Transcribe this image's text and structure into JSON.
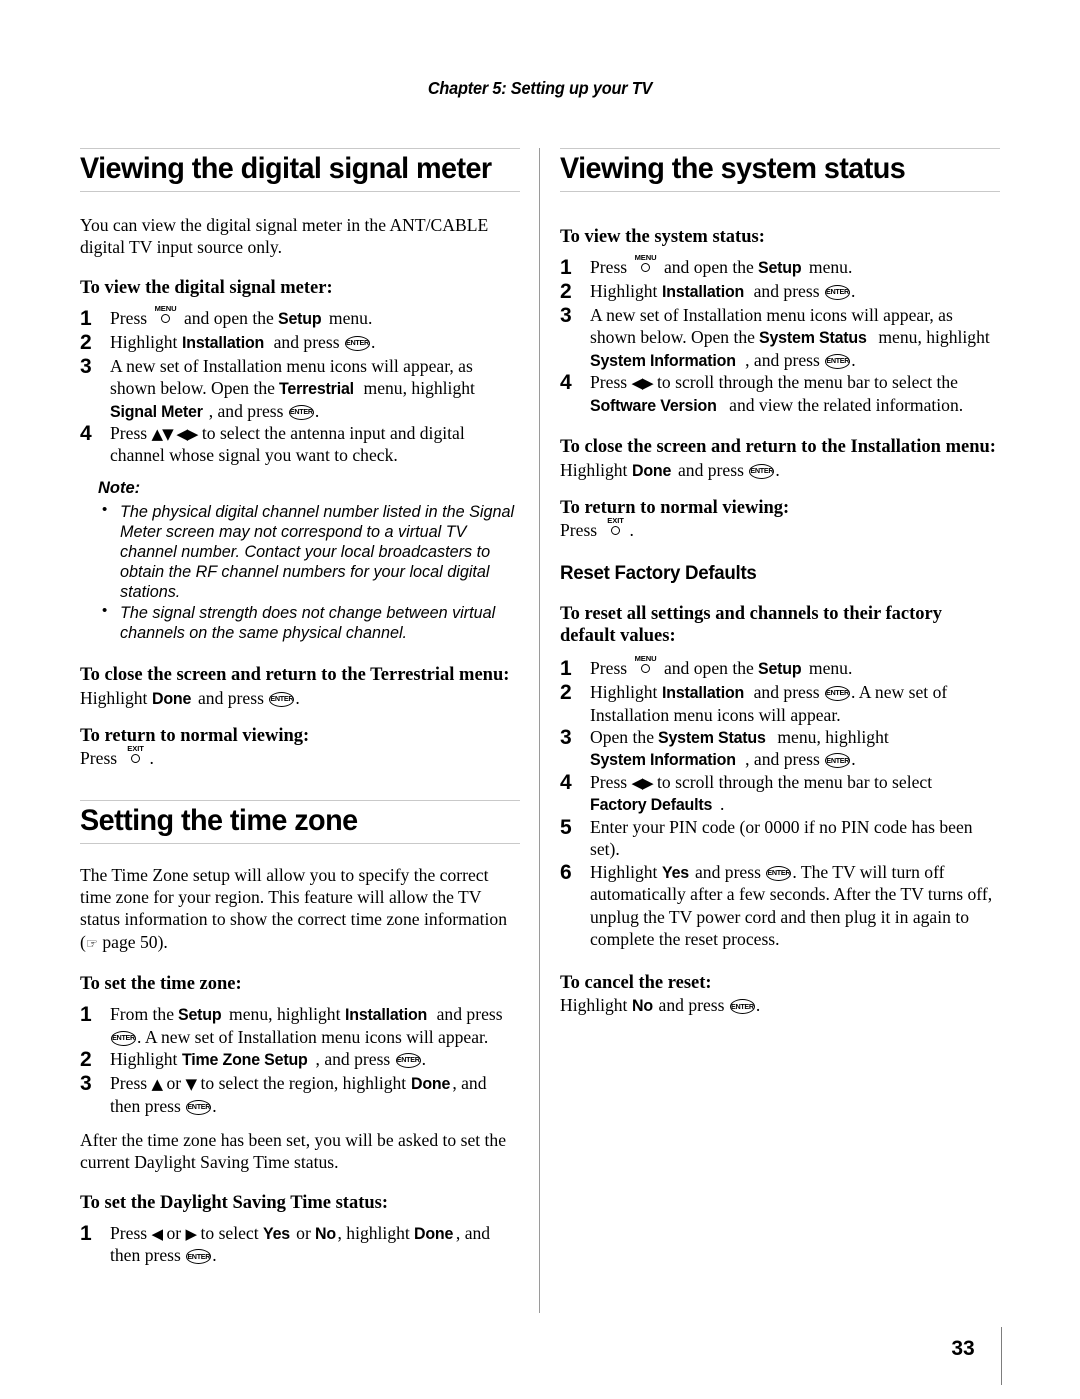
{
  "header": {
    "running_head": "Chapter 5: Setting up your TV"
  },
  "folio": {
    "page_number": "33"
  },
  "icons": {
    "menu_caption": "MENU",
    "exit_caption": "EXIT",
    "enter_caption": "ENTER",
    "up_arrow": "▲",
    "down_arrow": "▼",
    "left_arrow": "◀",
    "right_arrow": "▶",
    "hand_pointer": "☞"
  },
  "left_column": {
    "section1": {
      "title": "Viewing the digital signal meter",
      "intro": "You can view the digital signal meter in the ANT/CABLE digital TV input source only.",
      "proc1_title": "To view the digital signal meter:",
      "proc1_steps": [
        {
          "num": "1",
          "parts": [
            {
              "t": "text",
              "v": "Press "
            },
            {
              "t": "key-menu"
            },
            {
              "t": "text",
              "v": " and open the "
            },
            {
              "t": "bold",
              "v": "Setup"
            },
            {
              "t": "text",
              "v": " menu."
            }
          ]
        },
        {
          "num": "2",
          "parts": [
            {
              "t": "text",
              "v": "Highlight "
            },
            {
              "t": "bold",
              "v": "Installation"
            },
            {
              "t": "text",
              "v": " and press "
            },
            {
              "t": "key-enter"
            },
            {
              "t": "text",
              "v": "."
            }
          ]
        },
        {
          "num": "3",
          "parts": [
            {
              "t": "text",
              "v": "A new set of Installation menu icons will appear, as shown below. Open the "
            },
            {
              "t": "bold",
              "v": "Terrestrial"
            },
            {
              "t": "text",
              "v": " menu, highlight "
            },
            {
              "t": "bold",
              "v": "Signal Meter"
            },
            {
              "t": "text",
              "v": ", and press "
            },
            {
              "t": "key-enter"
            },
            {
              "t": "text",
              "v": "."
            }
          ]
        },
        {
          "num": "4",
          "parts": [
            {
              "t": "text",
              "v": "Press "
            },
            {
              "t": "arrows",
              "v": "▲▼ ◀▶"
            },
            {
              "t": "text",
              "v": " to select the antenna input and digital channel whose signal you want to check."
            }
          ]
        }
      ],
      "note_title": "Note:",
      "note_items": [
        "The physical digital channel number listed in the Signal Meter screen may not correspond to a virtual TV channel number. Contact your local broadcasters to obtain the RF channel numbers for your local digital stations.",
        "The signal strength does not change between virtual channels on the same physical channel."
      ],
      "proc2_title": "To close the screen and return to the Terrestrial menu:",
      "proc2_body": [
        {
          "t": "text",
          "v": "Highlight "
        },
        {
          "t": "bold",
          "v": "Done"
        },
        {
          "t": "text",
          "v": " and press "
        },
        {
          "t": "key-enter"
        },
        {
          "t": "text",
          "v": "."
        }
      ],
      "proc3_title": "To return to normal viewing:",
      "proc3_body": [
        {
          "t": "text",
          "v": "Press "
        },
        {
          "t": "key-exit"
        },
        {
          "t": "text",
          "v": "."
        }
      ]
    },
    "section2": {
      "title": "Setting the time zone",
      "intro_parts": [
        {
          "t": "text",
          "v": "The Time Zone setup will allow you to specify the correct time zone for your region. This feature will allow the TV status information to show the correct time zone information ("
        },
        {
          "t": "hand"
        },
        {
          "t": "text",
          "v": " page 50)."
        }
      ],
      "proc1_title": "To set the time zone:",
      "proc1_steps": [
        {
          "num": "1",
          "parts": [
            {
              "t": "text",
              "v": "From the "
            },
            {
              "t": "bold",
              "v": "Setup"
            },
            {
              "t": "text",
              "v": " menu, highlight "
            },
            {
              "t": "bold",
              "v": "Installation"
            },
            {
              "t": "text",
              "v": " and press "
            },
            {
              "t": "key-enter"
            },
            {
              "t": "text",
              "v": ". A new set of Installation menu icons will appear."
            }
          ]
        },
        {
          "num": "2",
          "parts": [
            {
              "t": "text",
              "v": "Highlight "
            },
            {
              "t": "bold",
              "v": "Time Zone Setup"
            },
            {
              "t": "text",
              "v": ", and press "
            },
            {
              "t": "key-enter"
            },
            {
              "t": "text",
              "v": "."
            }
          ]
        },
        {
          "num": "3",
          "parts": [
            {
              "t": "text",
              "v": "Press "
            },
            {
              "t": "arrows",
              "v": "▲"
            },
            {
              "t": "text",
              "v": " or "
            },
            {
              "t": "arrows",
              "v": "▼"
            },
            {
              "t": "text",
              "v": " to select the region, highlight "
            },
            {
              "t": "bold",
              "v": "Done"
            },
            {
              "t": "text",
              "v": ", and then press "
            },
            {
              "t": "key-enter"
            },
            {
              "t": "text",
              "v": "."
            }
          ]
        }
      ],
      "after_text": "After the time zone has been set, you will be asked to set the current Daylight Saving Time status.",
      "proc2_title": "To set the Daylight Saving Time status:",
      "proc2_steps": [
        {
          "num": "1",
          "parts": [
            {
              "t": "text",
              "v": "Press "
            },
            {
              "t": "arrows",
              "v": "◀"
            },
            {
              "t": "text",
              "v": " or "
            },
            {
              "t": "arrows",
              "v": "▶"
            },
            {
              "t": "text",
              "v": " to select "
            },
            {
              "t": "bold",
              "v": "Yes"
            },
            {
              "t": "text",
              "v": " or "
            },
            {
              "t": "bold",
              "v": "No"
            },
            {
              "t": "text",
              "v": ", highlight "
            },
            {
              "t": "bold",
              "v": "Done"
            },
            {
              "t": "text",
              "v": ", and then press "
            },
            {
              "t": "key-enter"
            },
            {
              "t": "text",
              "v": "."
            }
          ]
        }
      ]
    }
  },
  "right_column": {
    "section1": {
      "title": "Viewing the system status",
      "proc1_title": "To view the system status:",
      "proc1_steps": [
        {
          "num": "1",
          "parts": [
            {
              "t": "text",
              "v": "Press "
            },
            {
              "t": "key-menu"
            },
            {
              "t": "text",
              "v": " and open the "
            },
            {
              "t": "bold",
              "v": "Setup"
            },
            {
              "t": "text",
              "v": " menu."
            }
          ]
        },
        {
          "num": "2",
          "parts": [
            {
              "t": "text",
              "v": "Highlight "
            },
            {
              "t": "bold",
              "v": "Installation"
            },
            {
              "t": "text",
              "v": " and press "
            },
            {
              "t": "key-enter"
            },
            {
              "t": "text",
              "v": "."
            }
          ]
        },
        {
          "num": "3",
          "parts": [
            {
              "t": "text",
              "v": "A new set of Installation menu icons will appear, as shown below. Open the "
            },
            {
              "t": "bold",
              "v": "System Status"
            },
            {
              "t": "text",
              "v": " menu, highlight "
            },
            {
              "t": "bold",
              "v": "System Information"
            },
            {
              "t": "text",
              "v": ", and press "
            },
            {
              "t": "key-enter"
            },
            {
              "t": "text",
              "v": "."
            }
          ]
        },
        {
          "num": "4",
          "parts": [
            {
              "t": "text",
              "v": "Press "
            },
            {
              "t": "arrows",
              "v": "◀▶"
            },
            {
              "t": "text",
              "v": " to scroll through the menu bar to select the "
            },
            {
              "t": "bold",
              "v": "Software Version"
            },
            {
              "t": "text",
              "v": " and view the related information."
            }
          ]
        }
      ],
      "proc2_title": "To close the screen and return to the Installation menu:",
      "proc2_body": [
        {
          "t": "text",
          "v": "Highlight "
        },
        {
          "t": "bold",
          "v": "Done"
        },
        {
          "t": "text",
          "v": " and press "
        },
        {
          "t": "key-enter"
        },
        {
          "t": "text",
          "v": "."
        }
      ],
      "proc3_title": "To return to normal viewing:",
      "proc3_body": [
        {
          "t": "text",
          "v": "Press "
        },
        {
          "t": "key-exit"
        },
        {
          "t": "text",
          "v": "."
        }
      ]
    },
    "section2": {
      "title": "Reset Factory Defaults",
      "proc1_title": "To reset all settings and channels to their factory default values:",
      "proc1_steps": [
        {
          "num": "1",
          "parts": [
            {
              "t": "text",
              "v": "Press "
            },
            {
              "t": "key-menu"
            },
            {
              "t": "text",
              "v": " and open the "
            },
            {
              "t": "bold",
              "v": "Setup"
            },
            {
              "t": "text",
              "v": " menu."
            }
          ]
        },
        {
          "num": "2",
          "parts": [
            {
              "t": "text",
              "v": "Highlight "
            },
            {
              "t": "bold",
              "v": "Installation"
            },
            {
              "t": "text",
              "v": " and press "
            },
            {
              "t": "key-enter"
            },
            {
              "t": "text",
              "v": ". A new set of Installation menu icons will appear."
            }
          ]
        },
        {
          "num": "3",
          "parts": [
            {
              "t": "text",
              "v": "Open the "
            },
            {
              "t": "bold",
              "v": "System Status"
            },
            {
              "t": "text",
              "v": " menu, highlight "
            },
            {
              "t": "bold",
              "v": "System Information"
            },
            {
              "t": "text",
              "v": ", and press "
            },
            {
              "t": "key-enter"
            },
            {
              "t": "text",
              "v": "."
            }
          ]
        },
        {
          "num": "4",
          "parts": [
            {
              "t": "text",
              "v": "Press "
            },
            {
              "t": "arrows",
              "v": "◀▶"
            },
            {
              "t": "text",
              "v": " to scroll through the menu bar to select "
            },
            {
              "t": "bold",
              "v": "Factory Defaults"
            },
            {
              "t": "text",
              "v": "."
            }
          ]
        },
        {
          "num": "5",
          "parts": [
            {
              "t": "text",
              "v": "Enter your PIN code (or 0000 if no PIN code has been set)."
            }
          ]
        },
        {
          "num": "6",
          "parts": [
            {
              "t": "text",
              "v": "Highlight "
            },
            {
              "t": "bold",
              "v": "Yes"
            },
            {
              "t": "text",
              "v": " and press "
            },
            {
              "t": "key-enter"
            },
            {
              "t": "text",
              "v": ". The TV will turn off automatically after a few seconds. After the TV turns off, unplug the TV power cord and then plug it in again to complete the reset process."
            }
          ]
        }
      ],
      "proc2_title": "To cancel the reset:",
      "proc2_body": [
        {
          "t": "text",
          "v": "Highlight "
        },
        {
          "t": "bold",
          "v": "No"
        },
        {
          "t": "text",
          "v": " and press "
        },
        {
          "t": "key-enter"
        },
        {
          "t": "text",
          "v": "."
        }
      ]
    }
  }
}
